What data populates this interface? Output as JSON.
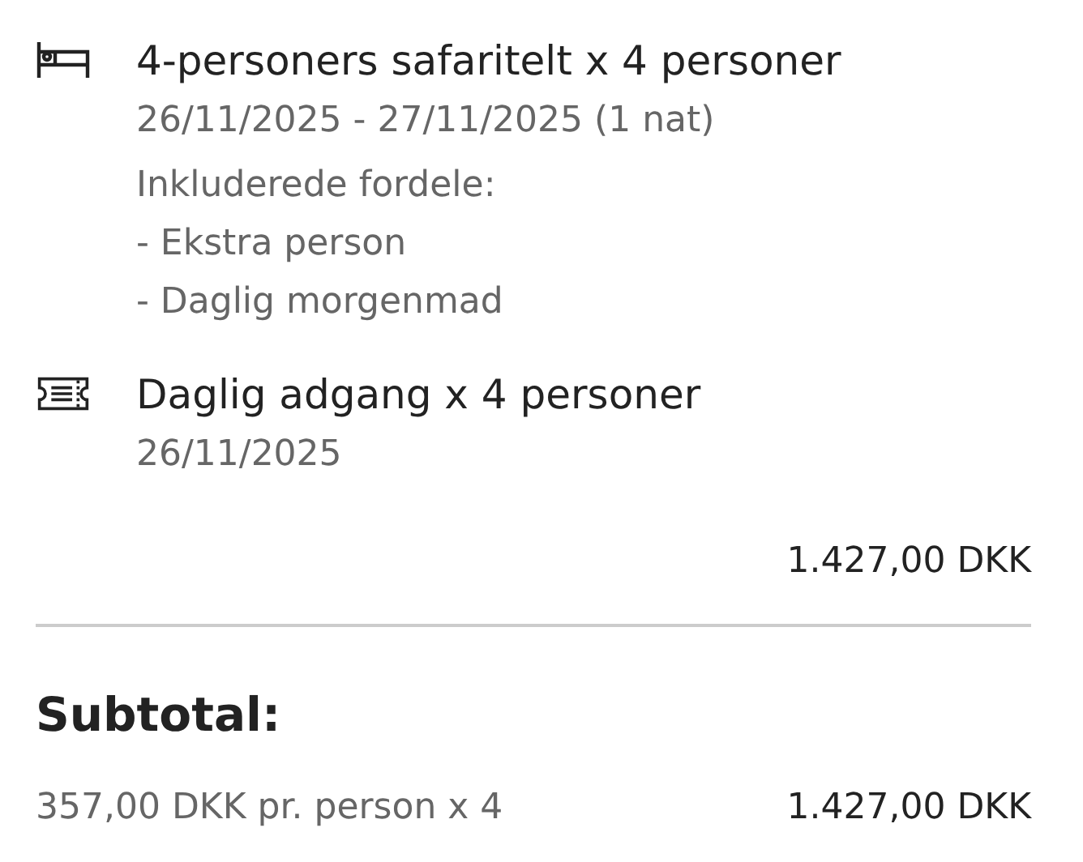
{
  "items": [
    {
      "kind": "bed",
      "title": "4-personers safaritelt x 4 personer",
      "lines": [
        "26/11/2025 - 27/11/2025 (1 nat)",
        "Inkluderede fordele:",
        "- Ekstra person",
        "- Daglig morgenmad"
      ]
    },
    {
      "kind": "ticket",
      "title": "Daglig adgang x 4 personer",
      "lines": [
        "26/11/2025"
      ]
    }
  ],
  "item_total": "1.427,00 DKK",
  "subtotal": {
    "label": "Subtotal:",
    "detail": "357,00 DKK pr. person x 4",
    "amount": "1.427,00 DKK"
  }
}
